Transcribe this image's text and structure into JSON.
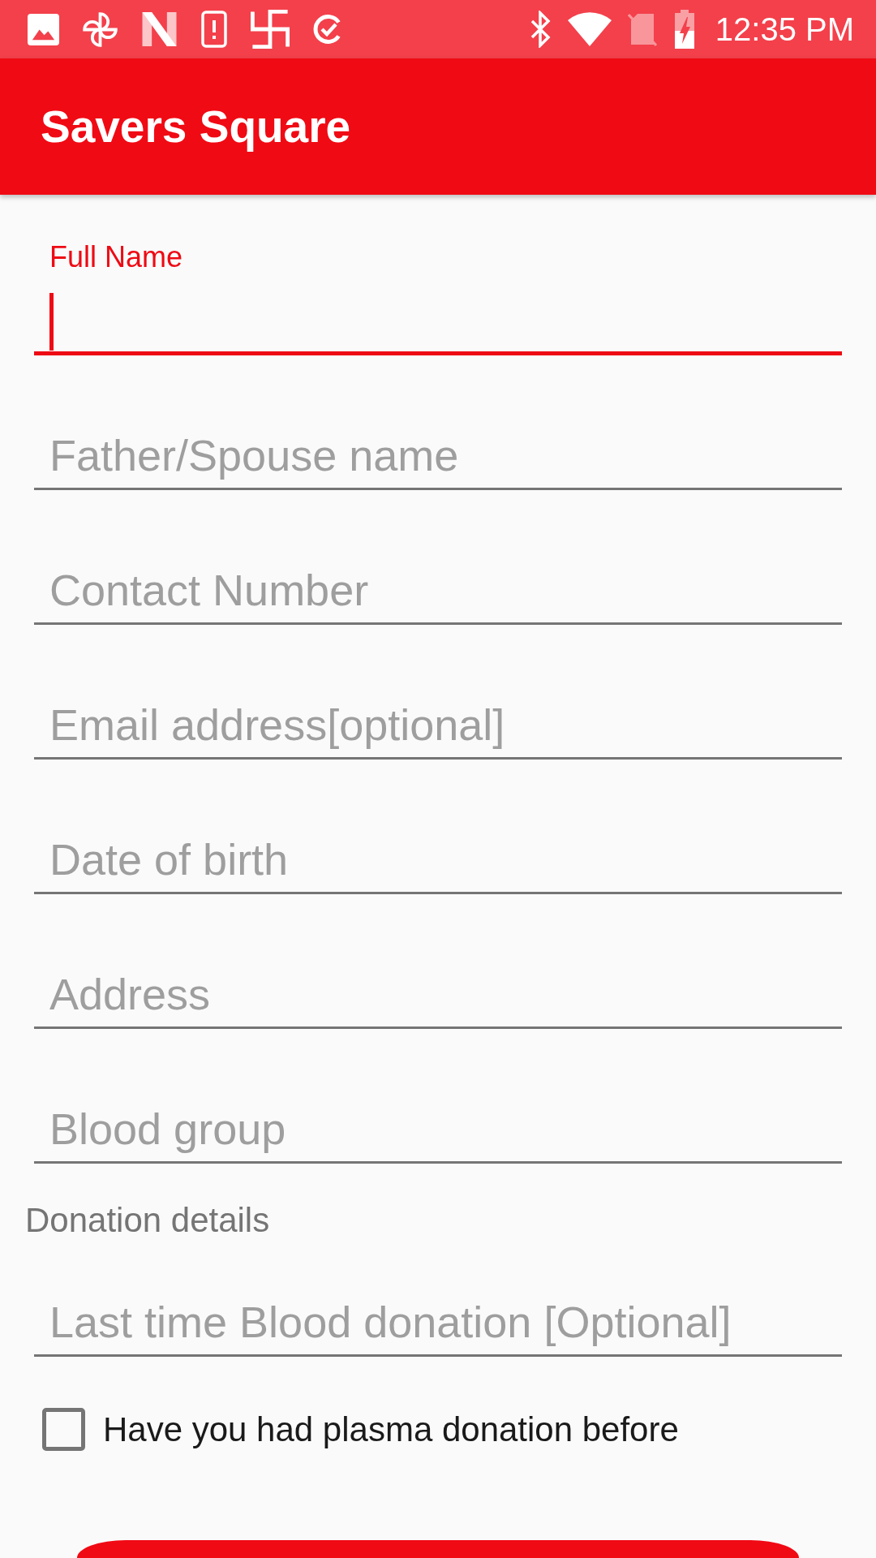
{
  "status_bar": {
    "time": "12:35 PM"
  },
  "app_bar": {
    "title": "Savers Square"
  },
  "personal_fields": [
    {
      "label": "Full Name",
      "focused": true
    },
    {
      "placeholder": "Father/Spouse name",
      "focused": false
    },
    {
      "placeholder": "Contact Number",
      "focused": false
    },
    {
      "placeholder": "Email address[optional]",
      "focused": false
    },
    {
      "placeholder": "Date of birth",
      "focused": false
    },
    {
      "placeholder": "Address",
      "focused": false
    },
    {
      "placeholder": "Blood group",
      "focused": false
    }
  ],
  "donation_section": {
    "heading": "Donation details",
    "fields": [
      {
        "placeholder": "Last time Blood donation [Optional]",
        "focused": false
      }
    ],
    "checkbox": {
      "label": "Have you had plasma donation before",
      "checked": false
    }
  },
  "bottom_button": {
    "kind": "filled"
  }
}
